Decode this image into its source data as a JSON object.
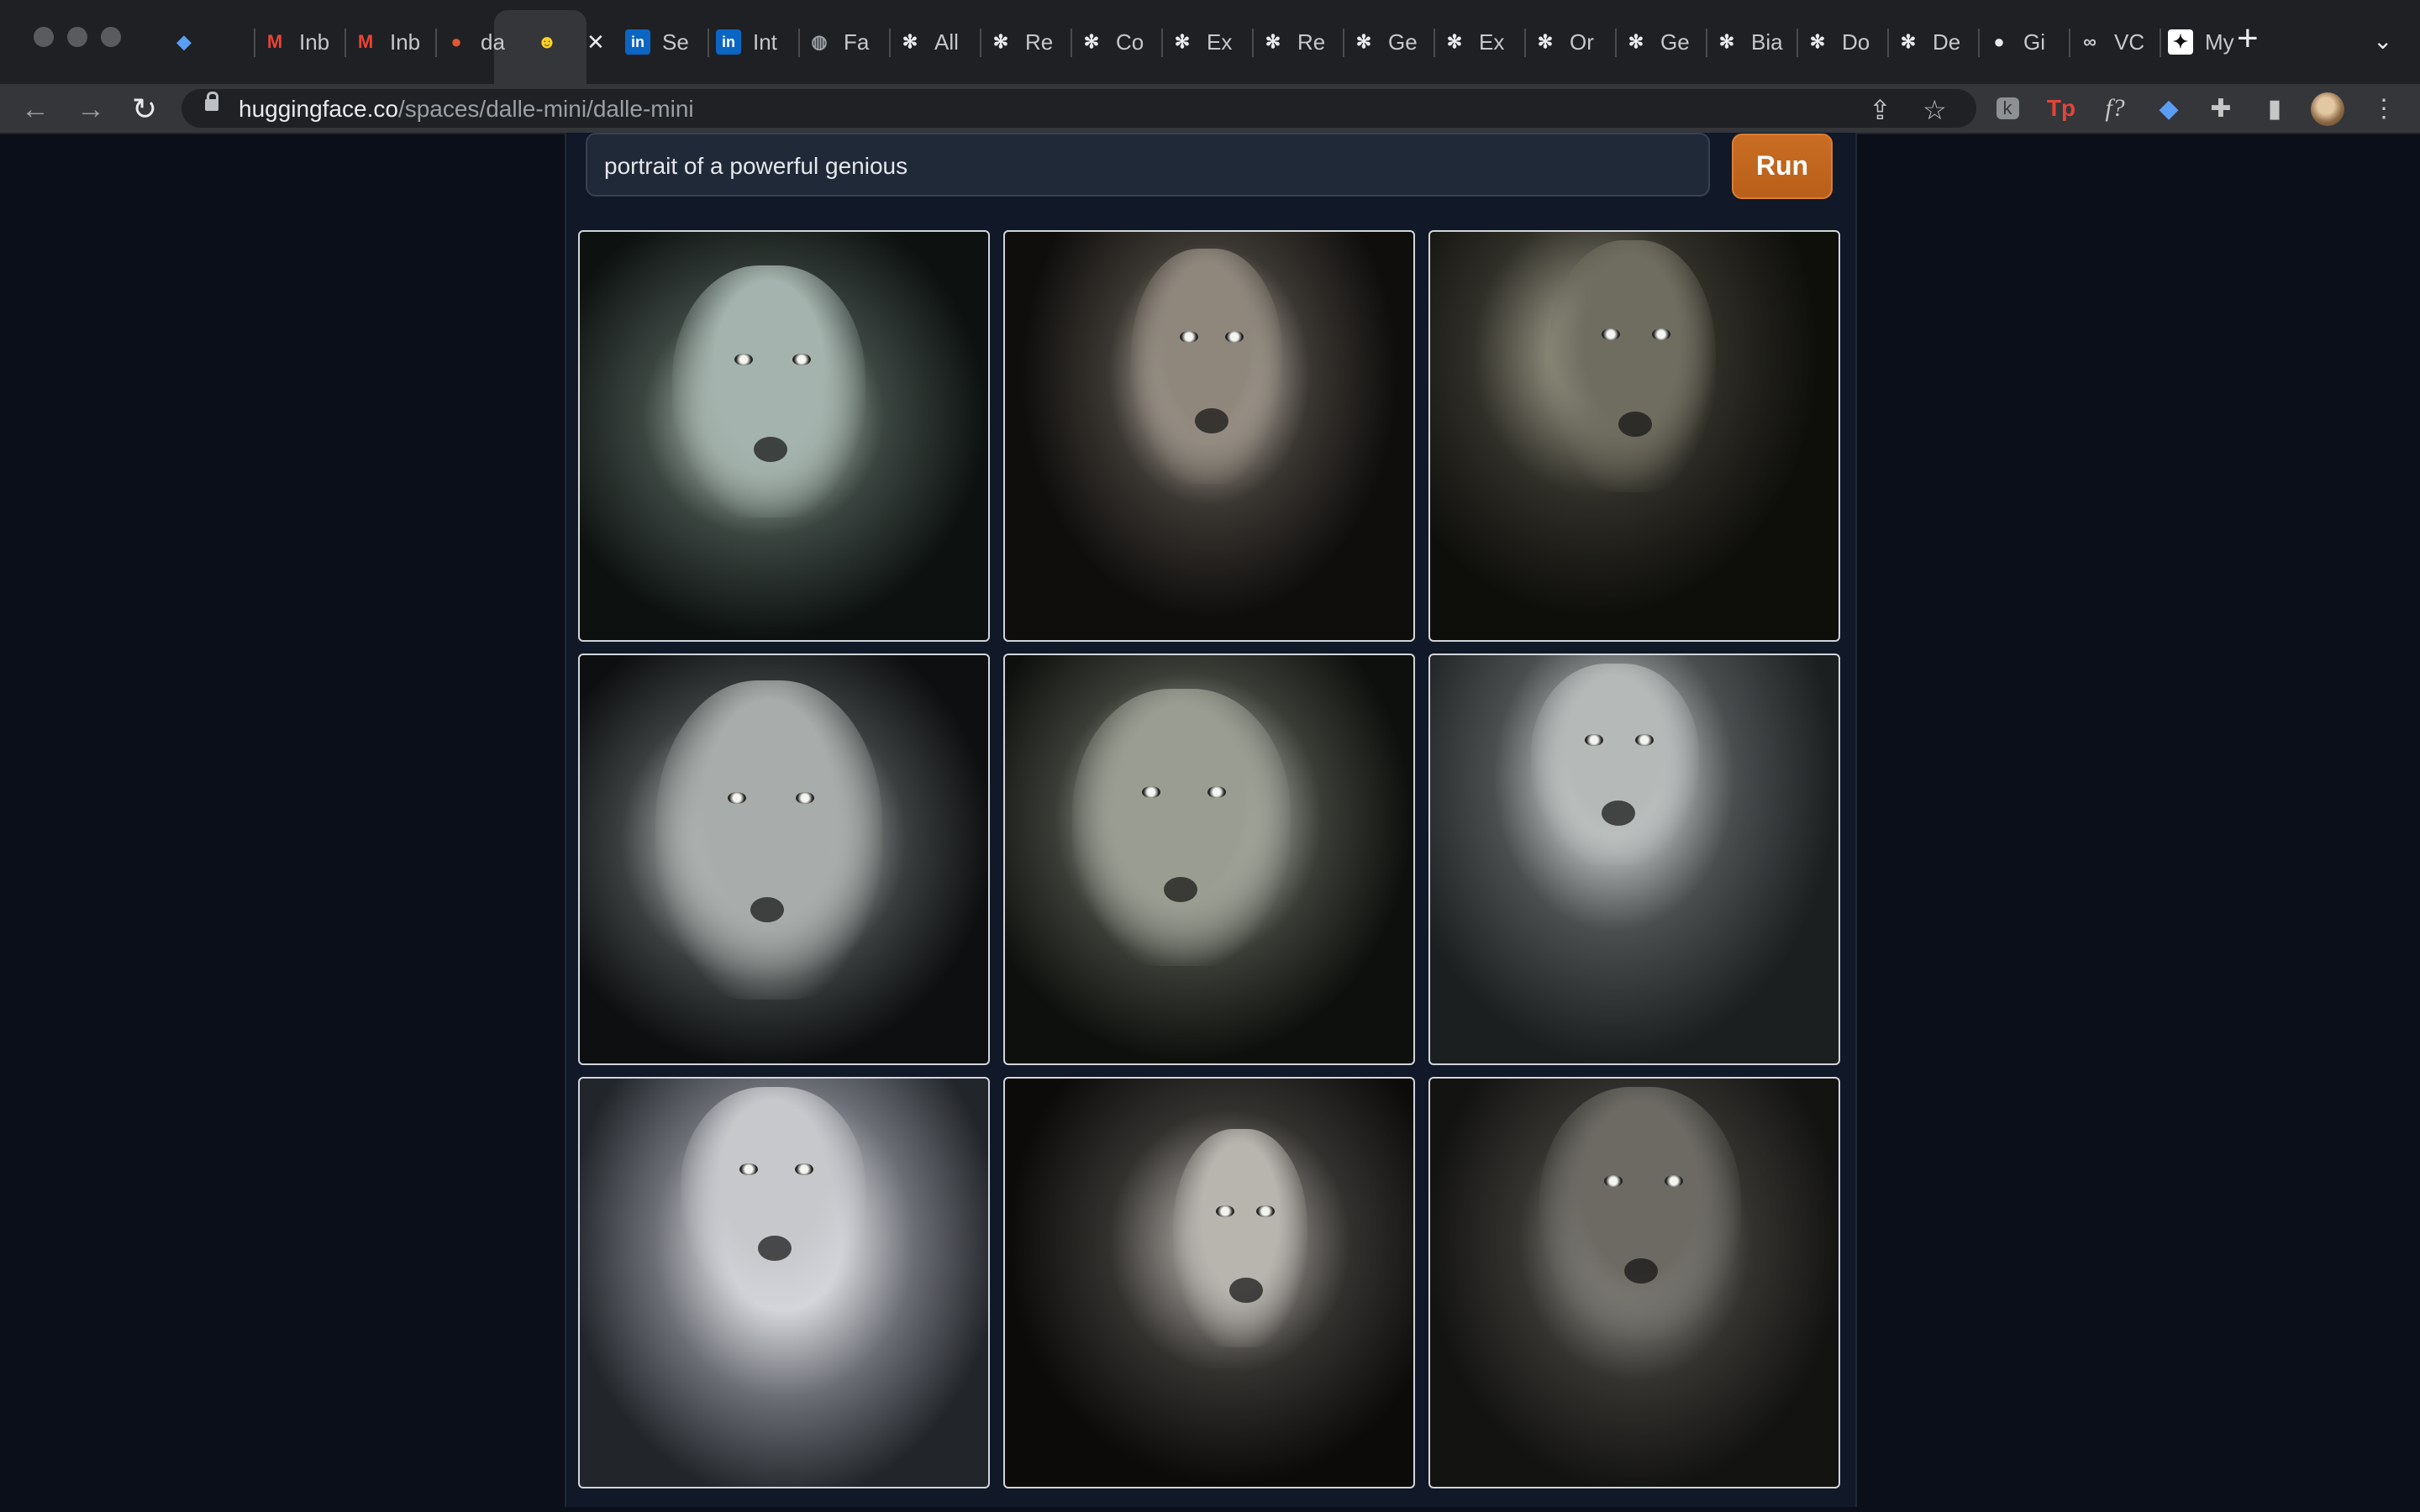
{
  "browser": {
    "tabs": [
      {
        "label": "",
        "icon": "diamond-icon"
      },
      {
        "label": "Inb",
        "icon": "gmail-icon"
      },
      {
        "label": "Inb",
        "icon": "gmail-icon"
      },
      {
        "label": "da",
        "icon": "duckduckgo-icon"
      },
      {
        "label": "",
        "icon": "huggingface-icon",
        "active": true
      },
      {
        "label": "Se",
        "icon": "linkedin-icon"
      },
      {
        "label": "Int",
        "icon": "linkedin-icon"
      },
      {
        "label": "Fa",
        "icon": "globe-icon"
      },
      {
        "label": "All",
        "icon": "openai-icon"
      },
      {
        "label": "Re",
        "icon": "openai-icon"
      },
      {
        "label": "Co",
        "icon": "openai-icon"
      },
      {
        "label": "Ex",
        "icon": "openai-icon"
      },
      {
        "label": "Re",
        "icon": "openai-icon"
      },
      {
        "label": "Ge",
        "icon": "openai-icon"
      },
      {
        "label": "Ex",
        "icon": "openai-icon"
      },
      {
        "label": "Or",
        "icon": "openai-icon"
      },
      {
        "label": "Ge",
        "icon": "openai-icon"
      },
      {
        "label": "Bia",
        "icon": "openai-icon"
      },
      {
        "label": "Do",
        "icon": "openai-icon"
      },
      {
        "label": "De",
        "icon": "openai-icon"
      },
      {
        "label": "Gi",
        "icon": "github-icon"
      },
      {
        "label": "VC",
        "icon": "infinity-icon"
      },
      {
        "label": "My",
        "icon": "star-logo-icon"
      }
    ],
    "url_host": "huggingface.co",
    "url_path": "/spaces/dalle-mini/dalle-mini",
    "extension_labels": {
      "tp": "Tp",
      "f": "f?"
    }
  },
  "app": {
    "prompt_value": "portrait of a powerful genious",
    "run_label": "Run",
    "images": [
      {
        "name": "generated-image-1"
      },
      {
        "name": "generated-image-2"
      },
      {
        "name": "generated-image-3"
      },
      {
        "name": "generated-image-4"
      },
      {
        "name": "generated-image-5"
      },
      {
        "name": "generated-image-6"
      },
      {
        "name": "generated-image-7"
      },
      {
        "name": "generated-image-8"
      },
      {
        "name": "generated-image-9"
      }
    ]
  },
  "colors": {
    "page_bg": "#0b0f19",
    "panel_bg": "#111827",
    "run_button": "#c96d23",
    "tabstrip_bg": "#1f2023",
    "toolbar_bg": "#35363a"
  }
}
